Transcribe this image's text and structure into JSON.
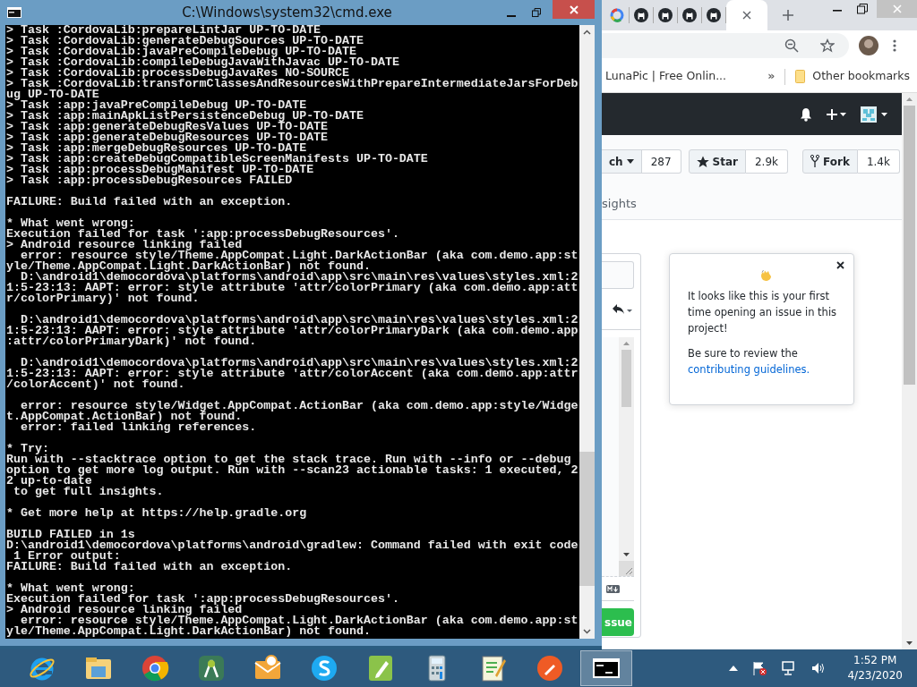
{
  "cmd_window": {
    "title": "C:\\Windows\\system32\\cmd.exe",
    "console_blocks": [
      [
        "> Task :CordovaLib:prepareLintJar UP-TO-DATE",
        "> Task :CordovaLib:generateDebugSources UP-TO-DATE",
        "> Task :CordovaLib:javaPreCompileDebug UP-TO-DATE",
        "> Task :CordovaLib:compileDebugJavaWithJavac UP-TO-DATE",
        "> Task :CordovaLib:processDebugJavaRes NO-SOURCE",
        "> Task :CordovaLib:transformClassesAndResourcesWithPrepareIntermediateJarsForDeb",
        "ug UP-TO-DATE",
        "> Task :app:javaPreCompileDebug UP-TO-DATE",
        "> Task :app:mainApkListPersistenceDebug UP-TO-DATE",
        "> Task :app:generateDebugResValues UP-TO-DATE",
        "> Task :app:generateDebugResources UP-TO-DATE",
        "> Task :app:mergeDebugResources UP-TO-DATE",
        "> Task :app:createDebugCompatibleScreenManifests UP-TO-DATE",
        "> Task :app:processDebugManifest UP-TO-DATE",
        "> Task :app:processDebugResources FAILED"
      ],
      [
        "FAILURE: Build failed with an exception."
      ],
      [
        "* What went wrong:",
        "Execution failed for task ':app:processDebugResources'.",
        "> Android resource linking failed",
        "  error: resource style/Theme.AppCompat.Light.DarkActionBar (aka com.demo.app:st",
        "yle/Theme.AppCompat.Light.DarkActionBar) not found.",
        "  D:\\android1\\democordova\\platforms\\android\\app\\src\\main\\res\\values\\styles.xml:2",
        "1:5-23:13: AAPT: error: style attribute 'attr/colorPrimary (aka com.demo.app:att",
        "r/colorPrimary)' not found."
      ],
      [
        "  D:\\android1\\democordova\\platforms\\android\\app\\src\\main\\res\\values\\styles.xml:2",
        "1:5-23:13: AAPT: error: style attribute 'attr/colorPrimaryDark (aka com.demo.app",
        ":attr/colorPrimaryDark)' not found."
      ],
      [
        "  D:\\android1\\democordova\\platforms\\android\\app\\src\\main\\res\\values\\styles.xml:2",
        "1:5-23:13: AAPT: error: style attribute 'attr/colorAccent (aka com.demo.app:attr",
        "/colorAccent)' not found."
      ],
      [
        "  error: resource style/Widget.AppCompat.ActionBar (aka com.demo.app:style/Widge",
        "t.AppCompat.ActionBar) not found.",
        "  error: failed linking references."
      ],
      [
        "* Try:",
        "Run with --stacktrace option to get the stack trace. Run with --info or --debug",
        "option to get more log output. Run with --scan23 actionable tasks: 1 executed, 2",
        "2 up-to-date",
        " to get full insights."
      ],
      [
        "* Get more help at https://help.gradle.org"
      ],
      [
        "BUILD FAILED in 1s",
        "D:\\android1\\democordova\\platforms\\android\\gradlew: Command failed with exit code",
        " 1 Error output:",
        "FAILURE: Build failed with an exception."
      ],
      [
        "* What went wrong:",
        "Execution failed for task ':app:processDebugResources'.",
        "> Android resource linking failed",
        "  error: resource style/Theme.AppCompat.Light.DarkActionBar (aka com.demo.app:st",
        "yle/Theme.AppCompat.Light.DarkActionBar) not found."
      ]
    ]
  },
  "browser": {
    "tabs": [
      {
        "kind": "google",
        "selected": false
      },
      {
        "kind": "github",
        "selected": false
      },
      {
        "kind": "github",
        "selected": false
      },
      {
        "kind": "github",
        "selected": false
      },
      {
        "kind": "github",
        "selected": false
      },
      {
        "kind": "blank",
        "selected": true
      }
    ],
    "bookmarks": [
      {
        "label": "LunaPic | Free Onlin..."
      }
    ],
    "bookmarks_overflow": "»",
    "other_bookmarks": "Other bookmarks",
    "repo_actions": [
      {
        "kind": "watch",
        "label": "ch",
        "count": "287"
      },
      {
        "kind": "star",
        "label": "Star",
        "count": "2.9k"
      },
      {
        "kind": "fork",
        "label": "Fork",
        "count": "1.4k"
      }
    ],
    "repo_tab": "sights",
    "submit_button": "ssue",
    "popover": {
      "paragraph": "It looks like this is your first time opening an issue in this project!",
      "note": "Be sure to review the",
      "link": "contributing guidelines."
    }
  },
  "taskbar": {
    "apps": [
      {
        "kind": "ie",
        "selected": false
      },
      {
        "kind": "explorer",
        "selected": false
      },
      {
        "kind": "chrome",
        "selected": false
      },
      {
        "kind": "studio",
        "selected": false
      },
      {
        "kind": "mail",
        "selected": false
      },
      {
        "kind": "skype",
        "selected": false
      },
      {
        "kind": "pen",
        "selected": false
      },
      {
        "kind": "calculator",
        "selected": false
      },
      {
        "kind": "notepad",
        "selected": false
      },
      {
        "kind": "postman",
        "selected": false
      },
      {
        "kind": "terminal",
        "selected": true
      }
    ],
    "time": "1:52 PM",
    "date": "4/23/2020"
  }
}
